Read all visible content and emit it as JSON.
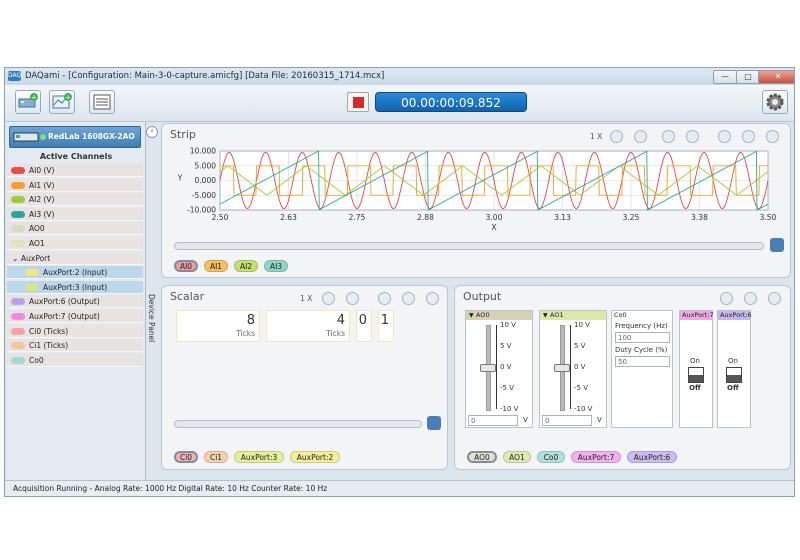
{
  "window": {
    "title": "DAQami - [Configuration: Main-3-0-capture.amicfg] [Data File: 20160315_1714.mcx]",
    "app_icon": "DAQ"
  },
  "window_controls": {
    "minimize": "—",
    "maximize": "□",
    "close": "✕"
  },
  "toolbar": {
    "timer": "00.00:00:09.852"
  },
  "device": {
    "name": "RedLab 1608GX-2AO"
  },
  "channels": {
    "header": "Active Channels",
    "items": [
      {
        "label": "AI0 (V)",
        "color": "#e05050",
        "selected": false
      },
      {
        "label": "AI1 (V)",
        "color": "#f0a030",
        "selected": false
      },
      {
        "label": "AI2 (V)",
        "color": "#9ccc3c",
        "selected": false
      },
      {
        "label": "AI3 (V)",
        "color": "#2aa899",
        "selected": false
      },
      {
        "label": "AO0",
        "color": "#d6dcc0",
        "selected": false
      },
      {
        "label": "AO1",
        "color": "#d9e6b8",
        "selected": false
      },
      {
        "label": "AuxPort",
        "color": "",
        "selected": false,
        "group": true
      },
      {
        "label": "AuxPort:2 (Input)",
        "color": "#f0e880",
        "selected": true
      },
      {
        "label": "AuxPort:3 (Input)",
        "color": "#d7e880",
        "selected": true
      },
      {
        "label": "AuxPort:6 (Output)",
        "color": "#b7a3ea",
        "selected": false
      },
      {
        "label": "AuxPort:7 (Output)",
        "color": "#f08ae0",
        "selected": false
      },
      {
        "label": "Ci0 (Ticks)",
        "color": "#f0a6a6",
        "selected": false
      },
      {
        "label": "Ci1 (Ticks)",
        "color": "#f0c8a0",
        "selected": false
      },
      {
        "label": "Co0",
        "color": "#a7d8d0",
        "selected": false
      }
    ]
  },
  "device_panel": {
    "label": "Device Panel",
    "collapse_glyph": "‹"
  },
  "strip": {
    "title": "Strip",
    "zoom": "1 X",
    "chips": [
      {
        "label": "AI0",
        "color": "#f29a9a",
        "active": true
      },
      {
        "label": "AI1",
        "color": "#f5c060",
        "active": false
      },
      {
        "label": "AI2",
        "color": "#c5e070",
        "active": false
      },
      {
        "label": "AI3",
        "color": "#8fd6c8",
        "active": false
      }
    ]
  },
  "chart_data": {
    "type": "line",
    "xlabel": "X",
    "ylabel": "Y",
    "xlim": [
      2.5,
      3.5
    ],
    "ylim": [
      -10,
      10
    ],
    "xticks": [
      "2.50",
      "2.63",
      "2.75",
      "2.88",
      "3.00",
      "3.13",
      "3.25",
      "3.38",
      "3.50"
    ],
    "yticks": [
      "10.000",
      "5.000",
      "0.000",
      "-5.000",
      "-10.000"
    ],
    "series": [
      {
        "color": "#e04848",
        "shape": "sine",
        "amplitude": 9.5,
        "cycles": 15,
        "phase": 0
      },
      {
        "color": "#f0a020",
        "shape": "square",
        "amplitude": 5,
        "cycles": 12,
        "phase": 0.2
      },
      {
        "color": "#a0cc30",
        "shape": "triangle",
        "amplitude": 5,
        "cycles": 7,
        "phase": 0.4
      },
      {
        "color": "#30a898",
        "shape": "sawtooth",
        "amplitude": 10,
        "cycles": 5,
        "phase": 0.1
      }
    ]
  },
  "scalar": {
    "title": "Scalar",
    "zoom": "1 X",
    "values": [
      {
        "value": "8",
        "unit": "Ticks"
      },
      {
        "value": "4",
        "unit": "Ticks"
      },
      {
        "value": "0",
        "unit": ""
      },
      {
        "value": "1",
        "unit": ""
      }
    ],
    "chips": [
      {
        "label": "Ci0",
        "color": "#f3b0b0",
        "active": true
      },
      {
        "label": "Ci1",
        "color": "#f5d1b0",
        "active": false
      },
      {
        "label": "AuxPort:3",
        "color": "#e6ef9a",
        "active": false
      },
      {
        "label": "AuxPort:2",
        "color": "#f5ee9a",
        "active": false
      }
    ]
  },
  "output": {
    "title": "Output",
    "ao": [
      {
        "name": "AO0",
        "value": "0",
        "unit": "V",
        "ticks": [
          "10 V",
          "5 V",
          "0 V",
          "-5 V",
          "-10 V"
        ],
        "header_color": "#d6d2b4",
        "level": 0.5
      },
      {
        "name": "AO1",
        "value": "0",
        "unit": "V",
        "ticks": [
          "10 V",
          "5 V",
          "0 V",
          "-5 V",
          "-10 V"
        ],
        "header_color": "#d9e8a8",
        "level": 0.5
      }
    ],
    "co": {
      "name": "Co0",
      "header_color": "#a7d6d2",
      "freq_label": "Frequency (Hz)",
      "freq_value": "100",
      "duty_label": "Duty Cycle (%)",
      "duty_value": "50"
    },
    "aux": [
      {
        "name": "AuxPort:7",
        "header_color": "#f0a8e8",
        "state_on": "On",
        "state_off": "Off"
      },
      {
        "name": "AuxPort:6",
        "header_color": "#c5b6f0",
        "state_on": "On",
        "state_off": "Off"
      }
    ],
    "chips": [
      {
        "label": "AO0",
        "color": "#e2e2cf",
        "active": true
      },
      {
        "label": "AO1",
        "color": "#dfeab0",
        "active": false
      },
      {
        "label": "Co0",
        "color": "#b4e0da",
        "active": false
      },
      {
        "label": "AuxPort:7",
        "color": "#f3b2ee",
        "active": false
      },
      {
        "label": "AuxPort:6",
        "color": "#cbbcf2",
        "active": false
      }
    ]
  },
  "status": {
    "text": "Acquisition Running - Analog Rate: 1000 Hz Digital Rate: 10 Hz Counter Rate: 10 Hz"
  }
}
